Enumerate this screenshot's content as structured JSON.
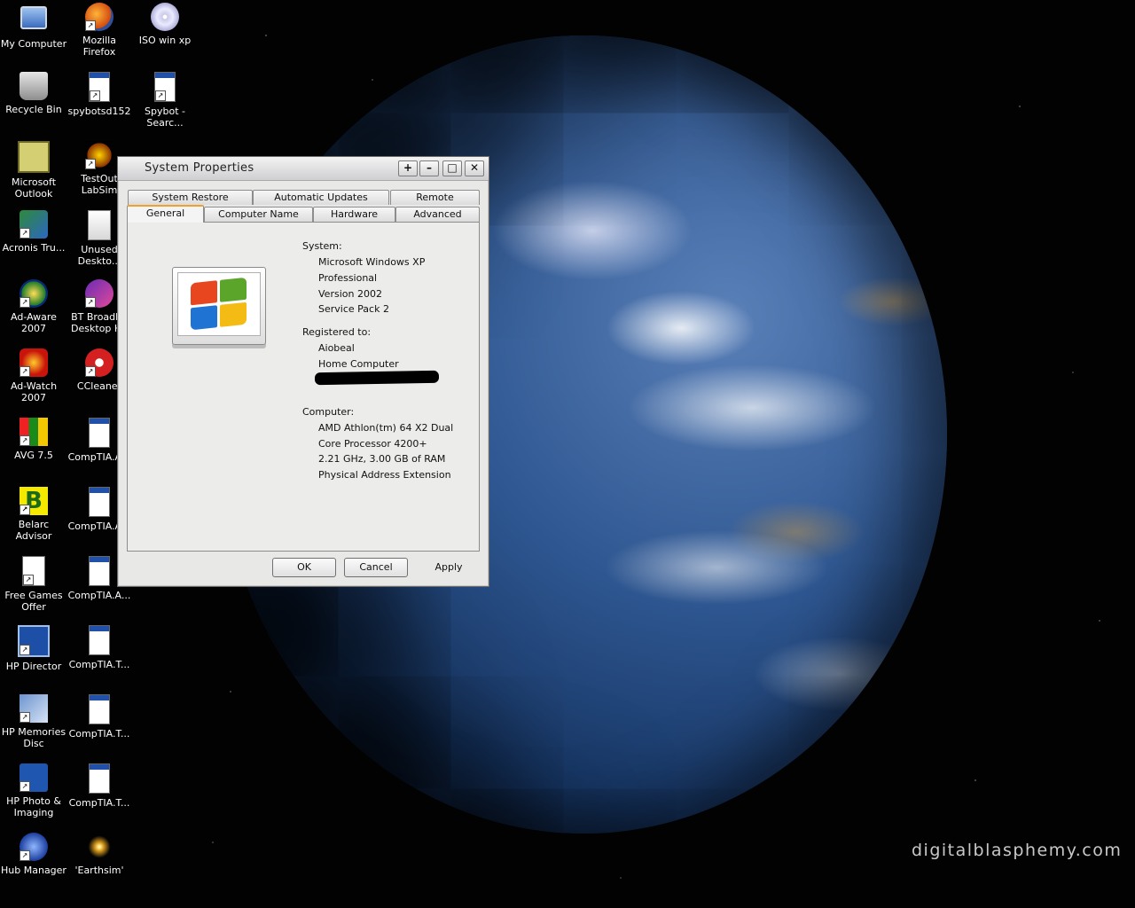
{
  "desktop": {
    "watermark": "digitalblasphemy.com",
    "icons": [
      {
        "label": "My Computer",
        "icon": "computer-icon"
      },
      {
        "label": "Mozilla Firefox",
        "icon": "firefox-icon"
      },
      {
        "label": "ISO win xp",
        "icon": "cd-icon"
      },
      {
        "label": "Recycle Bin",
        "icon": "recycle-bin-icon"
      },
      {
        "label": "spybotsd152",
        "icon": "installer-icon"
      },
      {
        "label": "Spybot - Searc...",
        "icon": "spybot-icon"
      },
      {
        "label": "Microsoft Outlook",
        "icon": "outlook-icon"
      },
      {
        "label": "TestOut LabSim",
        "icon": "testout-icon"
      },
      {
        "label": "Acronis Tru...",
        "icon": "acronis-icon"
      },
      {
        "label": "Unused Deskto...",
        "icon": "folder-icon"
      },
      {
        "label": "Ad-Aware 2007",
        "icon": "adaware-icon"
      },
      {
        "label": "BT Broadba Desktop He",
        "icon": "bt-icon"
      },
      {
        "label": "Ad-Watch 2007",
        "icon": "adwatch-icon"
      },
      {
        "label": "CCleaner",
        "icon": "ccleaner-icon"
      },
      {
        "label": "AVG 7.5",
        "icon": "avg-icon"
      },
      {
        "label": "CompTIA.A...",
        "icon": "document-icon"
      },
      {
        "label": "Belarc Advisor",
        "icon": "belarc-icon"
      },
      {
        "label": "CompTIA.A...",
        "icon": "document-icon"
      },
      {
        "label": "Free Games Offer",
        "icon": "games-icon"
      },
      {
        "label": "CompTIA.A...",
        "icon": "document-icon"
      },
      {
        "label": "HP Director",
        "icon": "hp-director-icon"
      },
      {
        "label": "CompTIA.T...",
        "icon": "document-icon"
      },
      {
        "label": "HP Memories Disc",
        "icon": "hp-memories-icon"
      },
      {
        "label": "CompTIA.T...",
        "icon": "document-icon"
      },
      {
        "label": "HP Photo & Imaging",
        "icon": "hp-photo-icon"
      },
      {
        "label": "CompTIA.T...",
        "icon": "document-icon"
      },
      {
        "label": "Hub Manager",
        "icon": "hub-icon"
      },
      {
        "label": "'Earthsim'",
        "icon": "earthsim-icon"
      }
    ]
  },
  "window": {
    "title": "System Properties",
    "buttons": {
      "help": "+",
      "minimize": "–",
      "maximize": "□",
      "close": "✕"
    },
    "tabs_back": [
      "System Restore",
      "Automatic Updates",
      "Remote"
    ],
    "tabs_front": [
      "General",
      "Computer Name",
      "Hardware",
      "Advanced"
    ],
    "active_tab": "General",
    "system": {
      "heading": "System:",
      "lines": [
        "Microsoft Windows XP",
        "Professional",
        "Version 2002",
        "Service Pack 2"
      ]
    },
    "registered": {
      "heading": "Registered to:",
      "lines": [
        "Aiobeal",
        "Home Computer"
      ]
    },
    "computer": {
      "heading": "Computer:",
      "lines": [
        "AMD Athlon(tm) 64 X2 Dual",
        "Core Processor 4200+",
        "2.21 GHz, 3.00 GB of RAM",
        "Physical Address Extension"
      ]
    },
    "footer": {
      "ok": "OK",
      "cancel": "Cancel",
      "apply": "Apply"
    }
  }
}
